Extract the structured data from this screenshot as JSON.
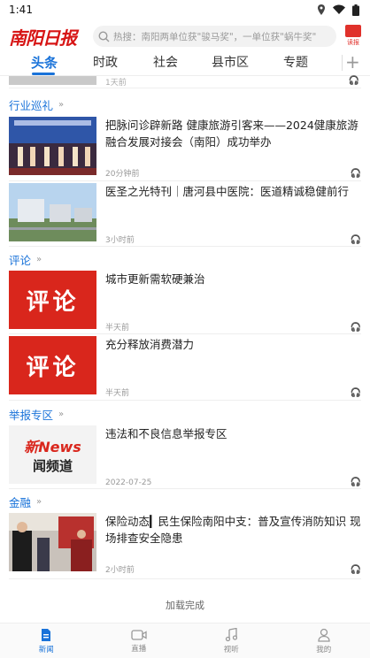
{
  "status": {
    "time": "1:41"
  },
  "header": {
    "logo_text": "南阳日报",
    "search_placeholder": "热搜：南阳两单位获\"骏马奖\"，一单位获\"蜗牛奖\"",
    "top_icon_label": "读报"
  },
  "tabs": [
    {
      "label": "头条",
      "active": true
    },
    {
      "label": "时政"
    },
    {
      "label": "社会"
    },
    {
      "label": "县市区"
    },
    {
      "label": "专题"
    }
  ],
  "feed": {
    "top_partial_time": "1天前",
    "sections": [
      {
        "title": "行业巡礼",
        "items": [
          {
            "title": "把脉问诊辟新路 健康旅游引客来——2024健康旅游融合发展对接会（南阳）成功举办",
            "time": "20分钟前"
          },
          {
            "title": "医圣之光特刊｜唐河县中医院：医道精诚稳健前行",
            "time": "3小时前"
          }
        ]
      },
      {
        "title": "评论",
        "items": [
          {
            "title": "城市更新需软硬兼治",
            "time": "半天前",
            "thumb_text": "评论"
          },
          {
            "title": "充分释放消费潜力",
            "time": "半天前",
            "thumb_text": "评论"
          }
        ]
      },
      {
        "title": "举报专区",
        "items": [
          {
            "title": "违法和不良信息举报专区",
            "time": "2022-07-25",
            "thumb_line1": "新News",
            "thumb_line2": "闻频道"
          }
        ]
      },
      {
        "title": "金融",
        "items": [
          {
            "title": "保险动态▎民生保险南阳中支：普及宣传消防知识  现场排查安全隐患",
            "time": "2小时前"
          }
        ]
      }
    ],
    "loaded_text": "加载完成"
  },
  "bottom_nav": [
    {
      "label": "新闻",
      "icon": "news-icon",
      "active": true
    },
    {
      "label": "直播",
      "icon": "live-icon"
    },
    {
      "label": "视听",
      "icon": "music-icon"
    },
    {
      "label": "我的",
      "icon": "user-icon"
    }
  ],
  "colors": {
    "accent": "#1a73d9",
    "brand_red": "#d71515"
  }
}
